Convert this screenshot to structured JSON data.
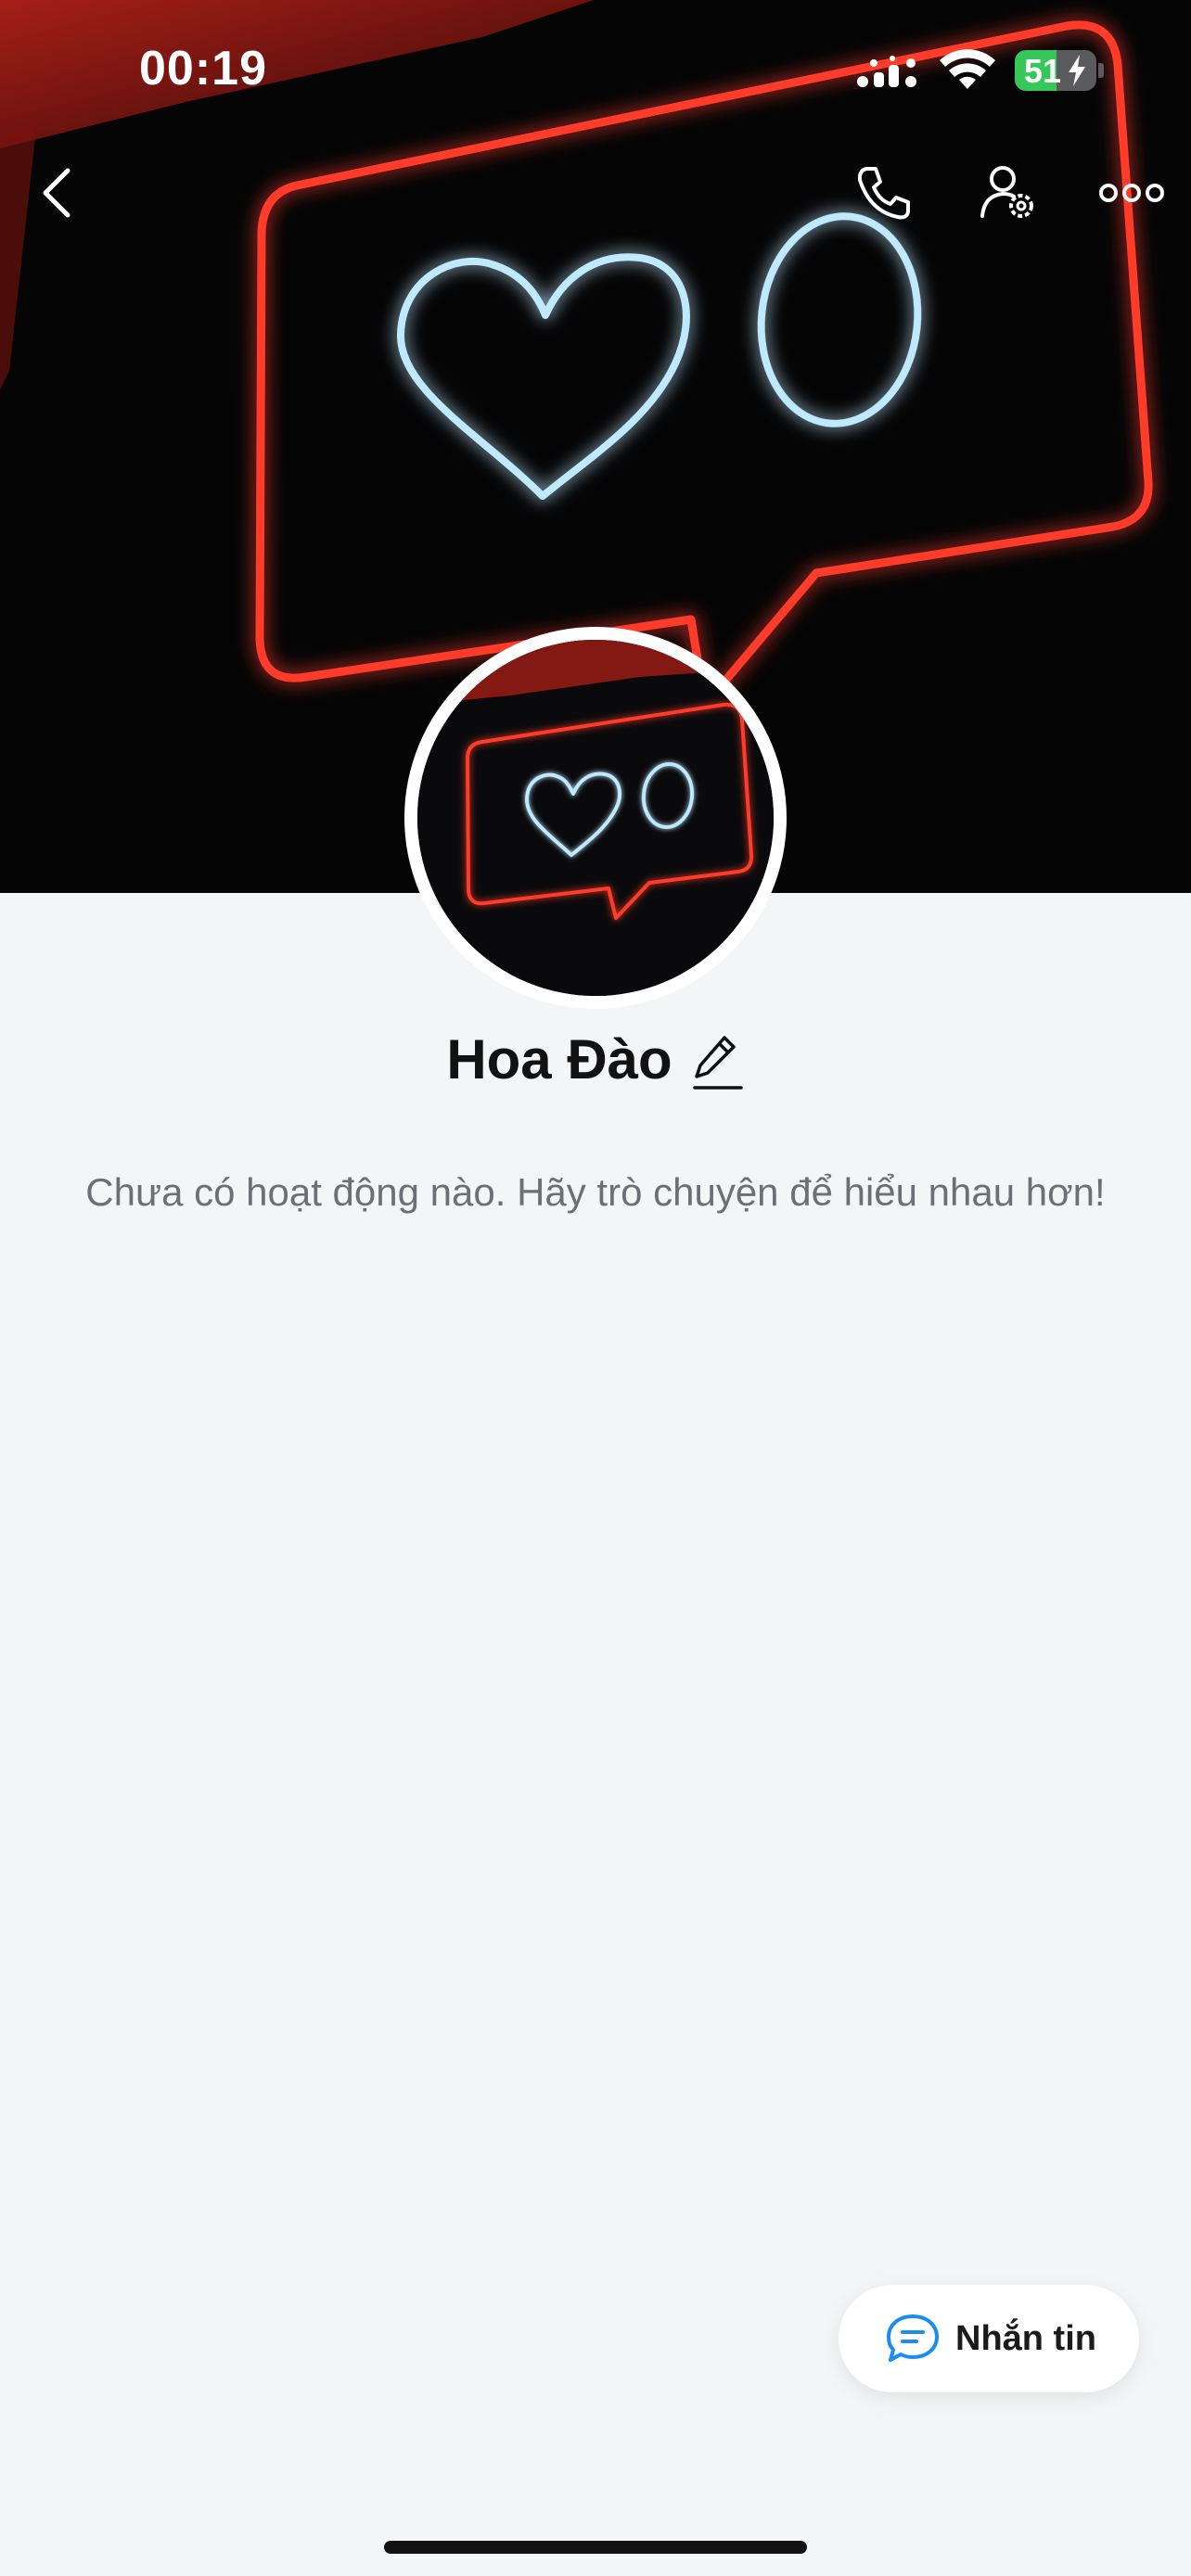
{
  "status_bar": {
    "time": "00:19",
    "battery": "51",
    "battery_level": 0.51,
    "signal_icon": "cellular-signal-icon",
    "wifi_icon": "wifi-icon",
    "battery_icon": "battery-charging-icon"
  },
  "nav": {
    "back_icon": "chevron-left-icon",
    "call_icon": "phone-icon",
    "settings_icon": "user-settings-icon",
    "more_icon": "more-horizontal-icon"
  },
  "profile": {
    "name": "Hoa Đào",
    "edit_icon": "pencil-icon",
    "empty_message": "Chưa có hoạt động nào. Hãy trò chuyện để hiểu nhau hơn!"
  },
  "message_button": {
    "label": "Nhắn tin",
    "icon": "chat-bubble-icon"
  },
  "colors": {
    "background": "#f4f5f7",
    "accent_blue": "#1d8cf0",
    "neon_red": "#ff3b2a",
    "neon_blue": "#bfe9ff",
    "battery_green": "#35c759"
  }
}
